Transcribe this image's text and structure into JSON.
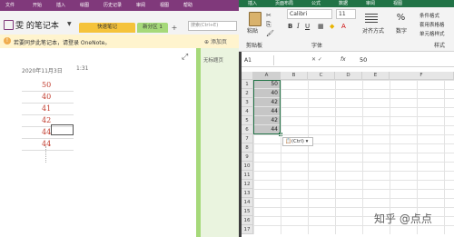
{
  "onenote": {
    "ribbon_tabs": [
      "文件",
      "开始",
      "插入",
      "绘图",
      "历史记录",
      "审阅",
      "视图",
      "帮助"
    ],
    "notebook_title": "雯 的笔记本",
    "section_tabs": [
      "快速笔记",
      "新分区 1"
    ],
    "add_section": "+",
    "search_placeholder": "搜索(Ctrl+E)",
    "notice_text": "若要同步此笔记本，请登录 OneNote。",
    "add_page": "添加页",
    "page_item": "无标题页",
    "date": "2020年11月3日",
    "time": "1:31",
    "numbers": [
      "50",
      "40",
      "41",
      "42",
      "44",
      "44",
      "..."
    ]
  },
  "excel": {
    "ribbon_tabs": [
      "插入",
      "页面布局",
      "公式",
      "数据",
      "审阅",
      "视图"
    ],
    "paste_label": "粘贴",
    "clipboard_label": "剪贴板",
    "font_name": "Calibri",
    "font_size": "11",
    "font_group_label": "字体",
    "align_label": "对齐方式",
    "number_label": "数字",
    "styles": [
      "条件格式",
      "套用表格格",
      "单元格样式"
    ],
    "styles_group_label": "样式",
    "namebox": "A1",
    "formula_value": "50",
    "fx": "fx",
    "columns": [
      "A",
      "B",
      "C",
      "D",
      "E",
      "F"
    ],
    "rows": [
      "1",
      "2",
      "3",
      "4",
      "5",
      "6",
      "7",
      "8",
      "9",
      "10",
      "11",
      "12",
      "13",
      "14",
      "15",
      "16",
      "17"
    ],
    "values": [
      "50",
      "40",
      "42",
      "44",
      "42",
      "44"
    ],
    "paste_options": "(Ctrl) ▾"
  },
  "watermark": "知乎 @点点"
}
